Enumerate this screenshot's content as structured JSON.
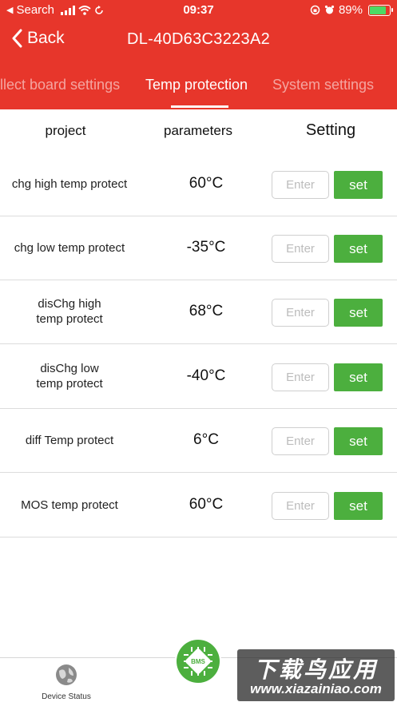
{
  "status_bar": {
    "carrier": "Search",
    "time": "09:37",
    "battery_percent": "89%",
    "battery_level": 0.89
  },
  "nav": {
    "back_label": "Back",
    "title": "DL-40D63C3223A2"
  },
  "tabs": [
    {
      "label": "llect board settings",
      "active": false
    },
    {
      "label": "Temp protection",
      "active": true
    },
    {
      "label": "System settings",
      "active": false
    }
  ],
  "table": {
    "headers": {
      "project": "project",
      "parameters": "parameters",
      "setting": "Setting"
    },
    "rows": [
      {
        "name": "chg high temp protect",
        "value": "60°C",
        "placeholder": "Enter",
        "button": "set"
      },
      {
        "name": "chg low temp protect",
        "value": "-35°C",
        "placeholder": "Enter",
        "button": "set"
      },
      {
        "name": "disChg high\ntemp protect",
        "value": "68°C",
        "placeholder": "Enter",
        "button": "set"
      },
      {
        "name": "disChg low\ntemp protect",
        "value": "-40°C",
        "placeholder": "Enter",
        "button": "set"
      },
      {
        "name": "diff Temp protect",
        "value": "6°C",
        "placeholder": "Enter",
        "button": "set"
      },
      {
        "name": "MOS temp protect",
        "value": "60°C",
        "placeholder": "Enter",
        "button": "set"
      }
    ]
  },
  "bottom_bar": {
    "device_status_label": "Device Status",
    "device_status_icon": "globe-icon",
    "bms_label": "BMS",
    "bms_icon": "chip-icon"
  },
  "watermark": {
    "title": "下载鸟应用",
    "url": "www.xiazainiao.com"
  },
  "colors": {
    "header": "#e7362b",
    "accent_green": "#4caf3e",
    "divider": "#dcdcdc"
  }
}
